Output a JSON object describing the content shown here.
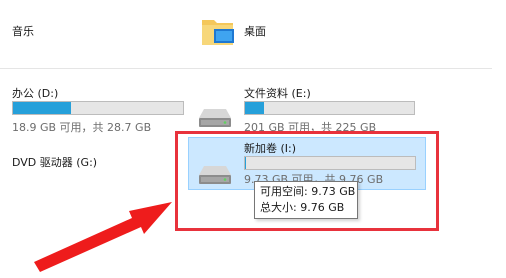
{
  "top": {
    "music_label": "音乐",
    "desktop_label": "桌面"
  },
  "drives": [
    {
      "name": "办公 (D:)",
      "usage": "18.9 GB 可用，共 28.7 GB",
      "used_fraction": 0.34
    },
    {
      "name": "文件资料 (E:)",
      "usage": "201 GB 可用，共 225 GB",
      "used_fraction": 0.11
    },
    {
      "name": "DVD 驱动器 (G:)"
    },
    {
      "name": "新加卷 (I:)",
      "usage": "9.73 GB 可用，共 9.76 GB",
      "used_fraction": 0.003
    }
  ],
  "tooltip": {
    "free_space": "可用空间: 9.73 GB",
    "total_size": "总大小: 9.76 GB"
  },
  "colors": {
    "bar_fill": "#26a0da",
    "selection": "#cce8ff",
    "highlight_red": "#e8323c"
  },
  "icons": {
    "music": "music-folder-icon",
    "desktop": "desktop-folder-icon",
    "drive": "hard-drive-icon"
  }
}
